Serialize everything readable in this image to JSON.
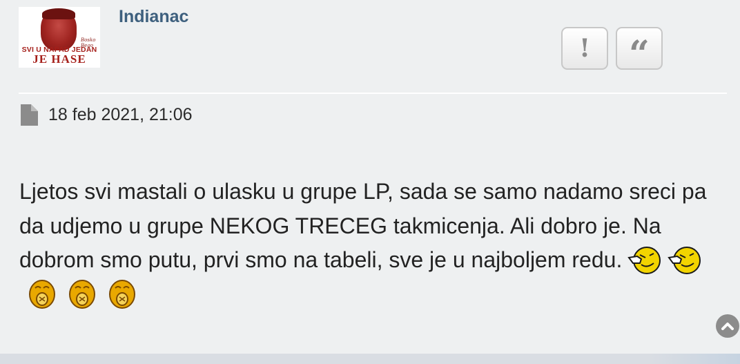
{
  "post": {
    "avatar": {
      "line1": "SVI U NAPAD JEDAN",
      "line2": "JE HASE",
      "tag": "Bosko Bego"
    },
    "username": "Indianac",
    "actions": {
      "report_icon": "exclamation-icon",
      "report_glyph": "!",
      "quote_icon": "quote-icon",
      "quote_glyph": "“"
    },
    "meta": {
      "icon": "file-icon",
      "date": "18 feb 2021, 21:06"
    },
    "content": {
      "text": "Ljetos svi mastali o ulasku u grupe LP, sada se samo nadamo sreci pa da udjemo u grupe NEKOG TRECEG takmicenja. Ali dobro je. Na dobrom smo putu, prvi smo na tabeli, sve je u najboljem redu.",
      "emoticons": [
        "pointing-laugh-icon",
        "pointing-laugh-icon",
        "crying-laugh-icon",
        "crying-laugh-icon",
        "crying-laugh-icon"
      ]
    },
    "scroll_top_icon": "chevron-up-icon"
  },
  "colors": {
    "username": "#3e607e",
    "background": "#eef0f1",
    "avatar_red": "#a51f1a"
  }
}
